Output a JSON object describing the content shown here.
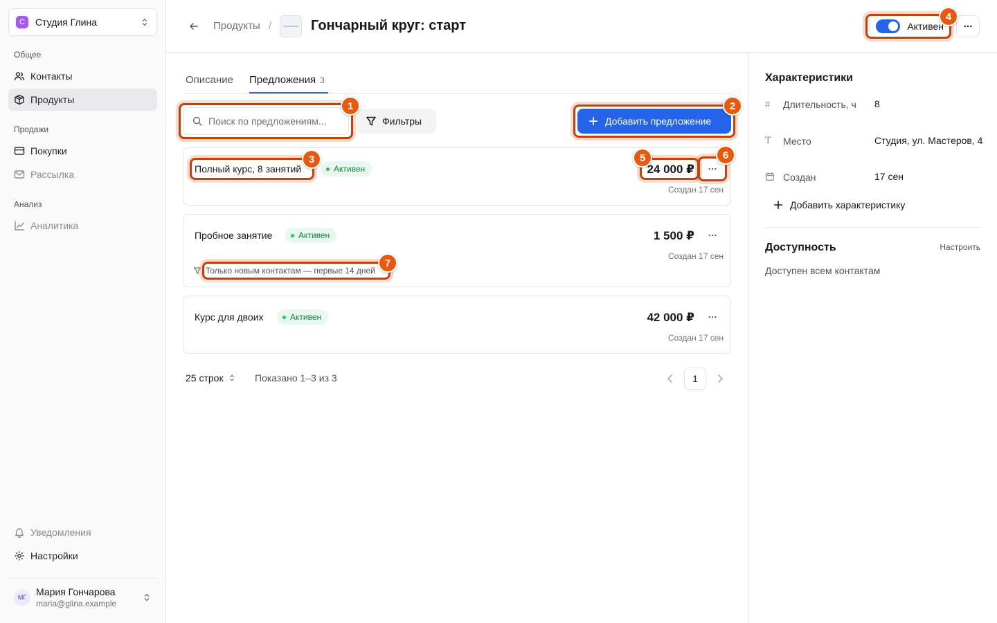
{
  "sidebar": {
    "workspace": {
      "initial": "С",
      "name": "Студия Глина"
    },
    "sections": {
      "general": "Общее",
      "sales": "Продажи",
      "analysis": "Анализ"
    },
    "items": [
      {
        "label": "Контакты"
      },
      {
        "label": "Продукты"
      },
      {
        "label": "Покупки"
      },
      {
        "label": "Рассылка"
      },
      {
        "label": "Аналитика"
      },
      {
        "label": "Уведомления"
      },
      {
        "label": "Настройки"
      }
    ],
    "user": {
      "initials": "МГ",
      "name": "Мария Гончарова",
      "email": "maria@glina.example"
    }
  },
  "header": {
    "breadcrumb": "Продукты",
    "separator": "/",
    "title": "Гончарный круг: старт",
    "status": "Активен"
  },
  "tabs": [
    {
      "label": "Описание"
    },
    {
      "label": "Предложения",
      "count": "3"
    }
  ],
  "toolbar": {
    "search_placeholder": "Поиск по предложениям...",
    "filters_label": "Фильтры",
    "add_label": "Добавить предложение"
  },
  "offers": [
    {
      "name": "Полный курс, 8 занятий",
      "status": "Активен",
      "price": "24 000 ₽",
      "created": "Создан 17 сен"
    },
    {
      "name": "Пробное занятие",
      "status": "Активен",
      "price": "1 500 ₽",
      "created": "Создан 17 сен",
      "restriction": "Только новым контактам — первые 14 дней"
    },
    {
      "name": "Курс для двоих",
      "status": "Активен",
      "price": "42 000 ₽",
      "created": "Создан 17 сен"
    }
  ],
  "pagination": {
    "rows_label": "25 строк",
    "showing": "Показано 1–3 из 3",
    "current_page": "1"
  },
  "panel": {
    "properties_title": "Характеристики",
    "properties": [
      {
        "icon": "hash-icon",
        "label": "Длительность, ч",
        "value": "8"
      },
      {
        "icon": "text-type-icon",
        "label": "Место",
        "value": "Студия, ул. Мастеров, 4"
      },
      {
        "icon": "calendar-icon",
        "label": "Создан",
        "value": "17 сен"
      }
    ],
    "add_property": "Добавить характеристику",
    "availability_title": "Доступность",
    "configure": "Настроить",
    "availability_text": "Доступен всем контактам"
  },
  "annotations": [
    "1",
    "2",
    "3",
    "4",
    "5",
    "6",
    "7"
  ],
  "colors": {
    "accent": "#2563eb",
    "annotation": "#ea580c",
    "badge_bg": "#e8f8ee",
    "badge_text": "#15803d",
    "workspace_logo": "#a855f7"
  }
}
